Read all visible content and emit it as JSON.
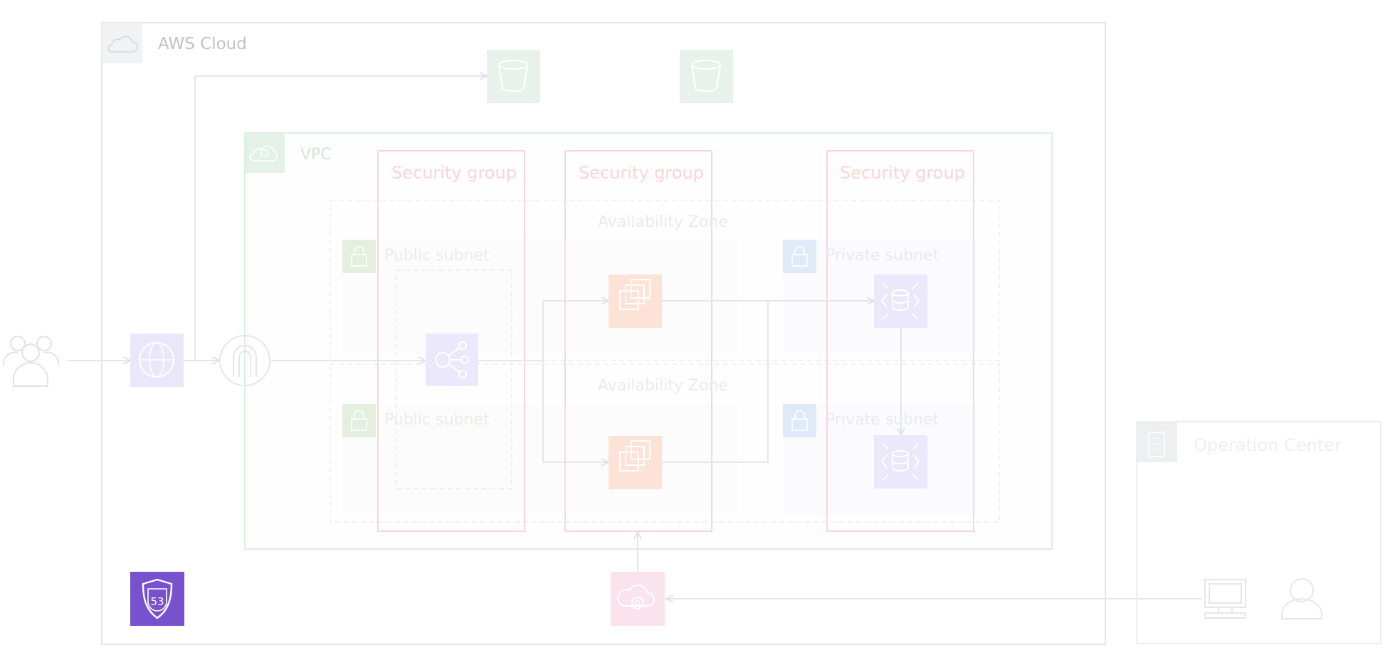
{
  "labels": {
    "cloud": "AWS Cloud",
    "vpc": "VPC",
    "security_group_1": "Security group",
    "security_group_2": "Security group",
    "security_group_3": "Security group",
    "availability_zone_1": "Availability Zone",
    "availability_zone_2": "Availability Zone",
    "public_subnet_1": "Public subnet",
    "public_subnet_2": "Public subnet",
    "private_subnet_1": "Private subnet",
    "private_subnet_2": "Private subnet",
    "operation_center": "Operation Center"
  },
  "icons": {
    "users": "users-icon",
    "cloudfront": "cloudfront-icon",
    "internet_gateway": "internet-gateway-icon",
    "s3_bucket_1": "s3-bucket-icon",
    "s3_bucket_2": "s3-bucket-icon",
    "load_balancer": "load-balancer-icon",
    "ec2_1": "ec2-icon",
    "ec2_2": "ec2-icon",
    "rds_1": "rds-icon",
    "rds_2": "rds-icon",
    "route53": "route53-icon",
    "route53_text": "53",
    "management": "management-icon",
    "computer": "computer-icon",
    "operator": "operator-icon",
    "lock": "lock-icon",
    "cloud": "cloud-icon",
    "vpc_cloud": "vpc-cloud-icon",
    "building": "building-icon"
  },
  "colors": {
    "cloud_border": "#e3e5e8",
    "vpc_border": "#d8eedf",
    "security_group": "#fbd3d3",
    "storage": "#e6f2e9",
    "networking": "#e9e6fa",
    "compute": "#fde3d6",
    "database": "#e9e6fa",
    "route53": "#7851cf",
    "management": "#fbe3ee",
    "public_subnet": "#e3efdf",
    "private_subnet": "#dfe9f8",
    "line": "#e4e6e8"
  }
}
